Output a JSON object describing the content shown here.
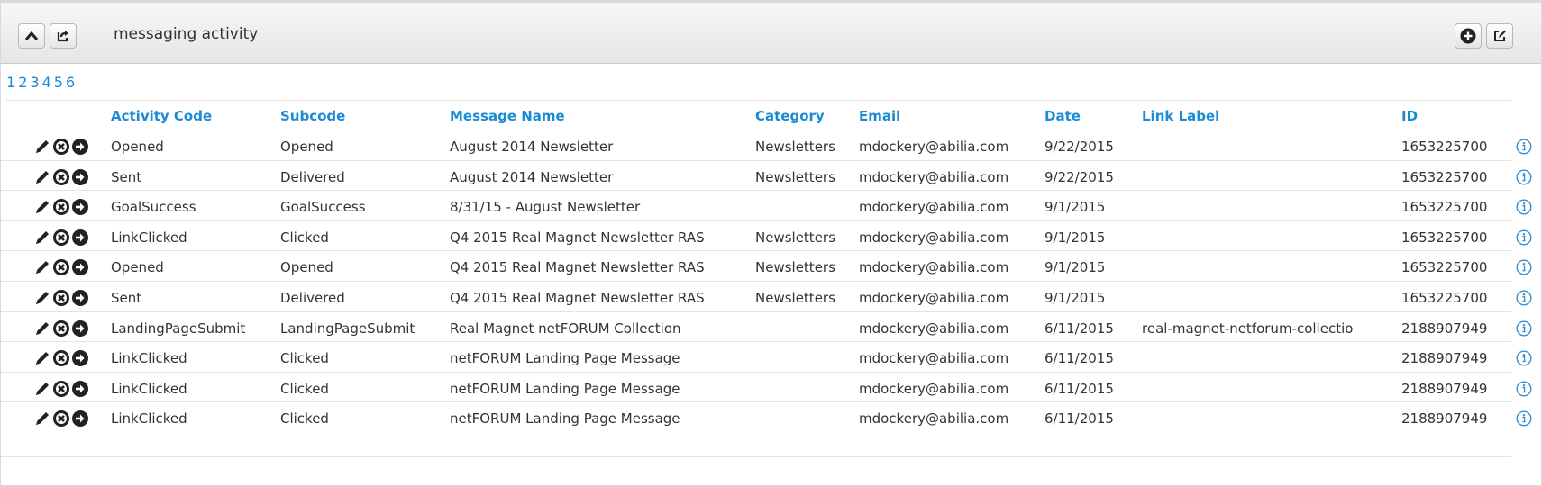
{
  "header": {
    "title": "messaging activity",
    "collapse_icon": "chevron-up-icon",
    "share_icon": "share-arrow-icon",
    "add_icon": "plus-circle-icon",
    "edit_icon": "edit-icon"
  },
  "pager": {
    "pages": [
      "1",
      "2",
      "3",
      "4",
      "5",
      "6"
    ]
  },
  "table": {
    "columns": [
      "Activity Code",
      "Subcode",
      "Message Name",
      "Category",
      "Email",
      "Date",
      "Link Label",
      "ID"
    ],
    "rows": [
      {
        "code": "Opened",
        "sub": "Opened",
        "msg": "August 2014 Newsletter",
        "cat": "Newsletters",
        "email": "mdockery@abilia.com",
        "date": "9/22/2015",
        "link": "",
        "id": "1653225700"
      },
      {
        "code": "Sent",
        "sub": "Delivered",
        "msg": "August 2014 Newsletter",
        "cat": "Newsletters",
        "email": "mdockery@abilia.com",
        "date": "9/22/2015",
        "link": "",
        "id": "1653225700"
      },
      {
        "code": "GoalSuccess",
        "sub": "GoalSuccess",
        "msg": "8/31/15 - August Newsletter",
        "cat": "",
        "email": "mdockery@abilia.com",
        "date": "9/1/2015",
        "link": "",
        "id": "1653225700"
      },
      {
        "code": "LinkClicked",
        "sub": "Clicked",
        "msg": "Q4 2015 Real Magnet Newsletter RAS",
        "cat": "Newsletters",
        "email": "mdockery@abilia.com",
        "date": "9/1/2015",
        "link": "",
        "id": "1653225700"
      },
      {
        "code": "Opened",
        "sub": "Opened",
        "msg": "Q4 2015 Real Magnet Newsletter RAS",
        "cat": "Newsletters",
        "email": "mdockery@abilia.com",
        "date": "9/1/2015",
        "link": "",
        "id": "1653225700"
      },
      {
        "code": "Sent",
        "sub": "Delivered",
        "msg": "Q4 2015 Real Magnet Newsletter RAS",
        "cat": "Newsletters",
        "email": "mdockery@abilia.com",
        "date": "9/1/2015",
        "link": "",
        "id": "1653225700"
      },
      {
        "code": "LandingPageSubmit",
        "sub": "LandingPageSubmit",
        "msg": "Real Magnet netFORUM Collection",
        "cat": "",
        "email": "mdockery@abilia.com",
        "date": "6/11/2015",
        "link": "real-magnet-netforum-collectio",
        "id": "2188907949"
      },
      {
        "code": "LinkClicked",
        "sub": "Clicked",
        "msg": "netFORUM Landing Page Message",
        "cat": "",
        "email": "mdockery@abilia.com",
        "date": "6/11/2015",
        "link": "",
        "id": "2188907949"
      },
      {
        "code": "LinkClicked",
        "sub": "Clicked",
        "msg": "netFORUM Landing Page Message",
        "cat": "",
        "email": "mdockery@abilia.com",
        "date": "6/11/2015",
        "link": "",
        "id": "2188907949"
      },
      {
        "code": "LinkClicked",
        "sub": "Clicked",
        "msg": "netFORUM Landing Page Message",
        "cat": "",
        "email": "mdockery@abilia.com",
        "date": "6/11/2015",
        "link": "",
        "id": "2188907949"
      }
    ],
    "row_action_icons": [
      "pencil-edit-icon",
      "remove-circle-icon",
      "go-arrow-circle-icon"
    ],
    "row_info_icon": "info-circle-icon"
  },
  "colors": {
    "link_blue": "#1a8ad4",
    "header_gradient_top": "#f7f7f7",
    "header_gradient_bottom": "#e6e6e6",
    "info_icon_blue": "#3b8fd0"
  }
}
